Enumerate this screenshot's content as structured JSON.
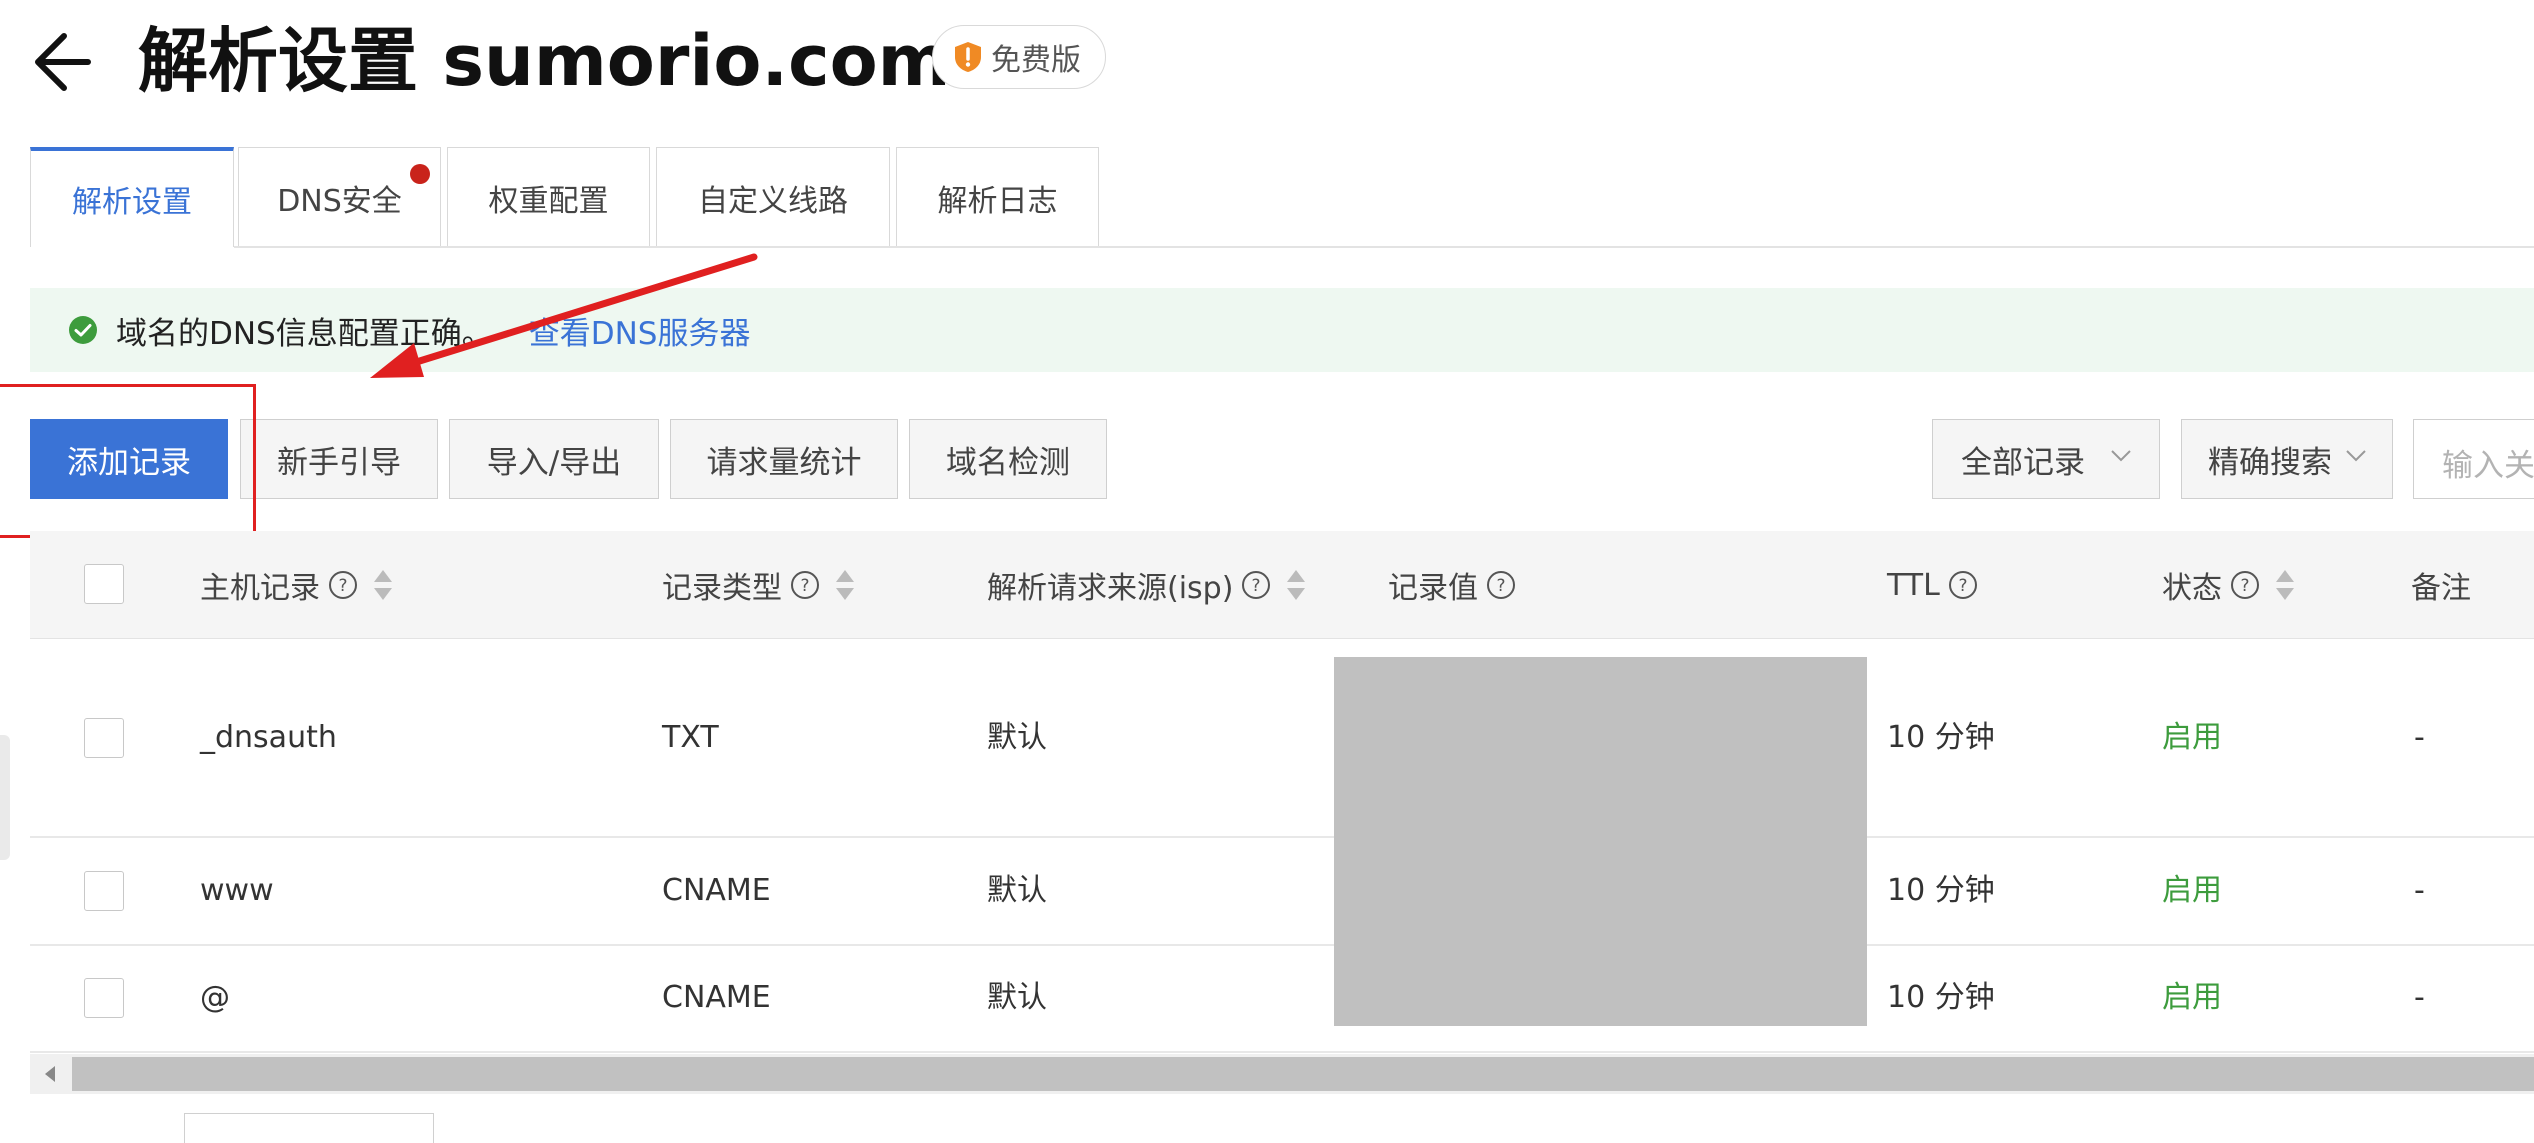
{
  "header": {
    "title": "解析设置 sumorio.com",
    "edition_badge": "免费版"
  },
  "tabs": [
    {
      "label": "解析设置",
      "active": true
    },
    {
      "label": "DNS安全",
      "has_dot": true
    },
    {
      "label": "权重配置"
    },
    {
      "label": "自定义线路"
    },
    {
      "label": "解析日志"
    }
  ],
  "alert": {
    "message": "域名的DNS信息配置正确。",
    "link": "查看DNS服务器"
  },
  "toolbar": {
    "add_record": "添加记录",
    "beginner_guide": "新手引导",
    "import_export": "导入/导出",
    "request_stats": "请求量统计",
    "domain_check": "域名检测",
    "record_filter": "全部记录",
    "search_mode": "精确搜索",
    "search_placeholder": "输入关"
  },
  "table": {
    "columns": {
      "host": "主机记录",
      "type": "记录类型",
      "isp": "解析请求来源(isp)",
      "value": "记录值",
      "ttl": "TTL",
      "status": "状态",
      "remark": "备注"
    },
    "rows": [
      {
        "host": "_dnsauth",
        "type": "TXT",
        "isp": "默认",
        "ttl": "10 分钟",
        "status": "启用",
        "remark": "-"
      },
      {
        "host": "www",
        "type": "CNAME",
        "isp": "默认",
        "ttl": "10 分钟",
        "status": "启用",
        "remark": "-"
      },
      {
        "host": "@",
        "type": "CNAME",
        "isp": "默认",
        "ttl": "10 分钟",
        "status": "启用",
        "remark": "-"
      }
    ]
  },
  "colors": {
    "accent": "#3a73d6",
    "status_enabled": "#3d9c3d",
    "annotation": "#e02020",
    "tab_dot": "#c9231b"
  }
}
